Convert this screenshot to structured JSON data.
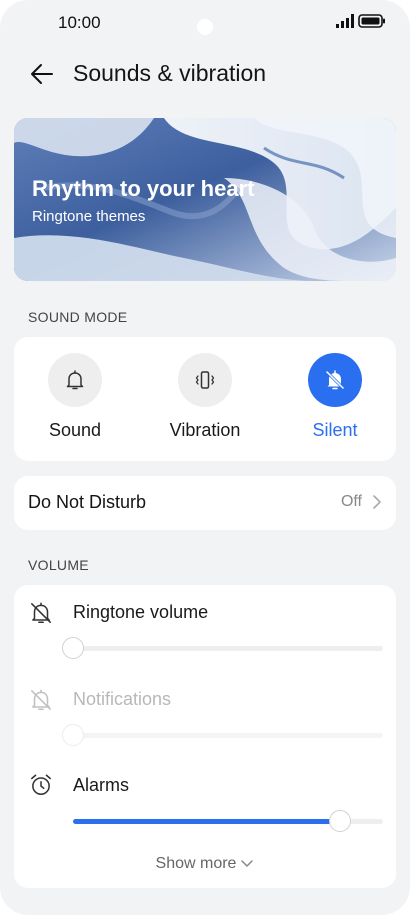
{
  "status_bar": {
    "time": "10:00",
    "signal_icon": "signal-icon",
    "battery_icon": "battery-icon"
  },
  "header": {
    "back_icon": "back-arrow-icon",
    "title": "Sounds & vibration"
  },
  "banner": {
    "title": "Rhythm to your heart",
    "subtitle": "Ringtone themes"
  },
  "sound_mode": {
    "section_label": "SOUND MODE",
    "options": [
      {
        "label": "Sound",
        "icon": "bell-icon",
        "selected": false
      },
      {
        "label": "Vibration",
        "icon": "vibration-icon",
        "selected": false
      },
      {
        "label": "Silent",
        "icon": "bell-off-icon",
        "selected": true
      }
    ]
  },
  "do_not_disturb": {
    "label": "Do Not Disturb",
    "value": "Off"
  },
  "volume": {
    "section_label": "VOLUME",
    "sliders": [
      {
        "label": "Ringtone volume",
        "icon": "bell-off-icon",
        "level": 0.0,
        "enabled": true
      },
      {
        "label": "Notifications",
        "icon": "bell-off-icon",
        "level": 0.0,
        "enabled": false
      },
      {
        "label": "Alarms",
        "icon": "alarm-clock-icon",
        "level": 0.86,
        "enabled": true
      }
    ],
    "show_more": "Show more"
  },
  "colors": {
    "accent": "#2a6ff0",
    "background": "#f1f3f5",
    "card": "#ffffff"
  }
}
